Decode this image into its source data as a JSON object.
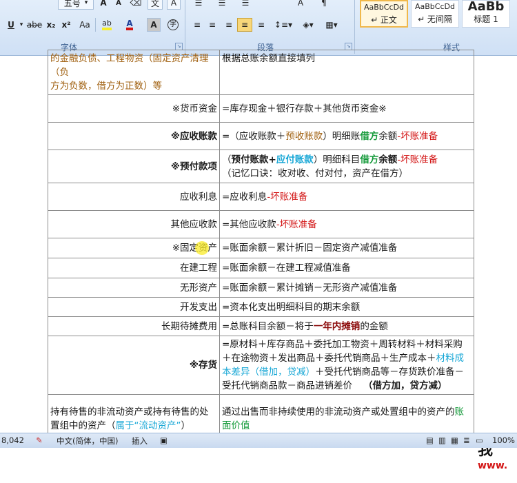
{
  "ribbon": {
    "font_size_value": "五号",
    "font_group_label": "字体",
    "paragraph_group_label": "段落",
    "styles_group_label": "样式",
    "format_buttons": [
      "U",
      "abe",
      "x₂",
      "x²",
      "Aa"
    ],
    "styles": [
      {
        "sample": "AaBbCcDd",
        "name": "↵ 正文"
      },
      {
        "sample": "AaBbCcDd",
        "name": "↵ 无间隔"
      },
      {
        "sample": "AaBb",
        "name": "标题 1"
      }
    ]
  },
  "document": {
    "top_row": {
      "left_line1": "的金融负债、工程物资（固定资产清理（负",
      "left_line2": "方为负数，借方为正数）等",
      "right": "根据总账余额直接填列"
    },
    "rows": [
      {
        "left": "※货币资金",
        "right": "=库存现金＋银行存款＋其他货币资金※"
      },
      {
        "left": "※应收账款",
        "right_a": "=（应收账款＋",
        "right_b": "预收账款",
        "right_c": "）明细账",
        "right_d": "借方",
        "right_e": "余额",
        "right_f": "-坏账准备"
      },
      {
        "left": "※预付款项",
        "right_a": "（",
        "right_b": "预付账款",
        "right_c": "+",
        "right_d": "应付账款",
        "right_e": "）明细科目",
        "right_f": "借方",
        "right_g": "余额",
        "right_h": "-坏账准备",
        "right_line2": "（记忆口诀：收对收、付对付，资产在借方）"
      },
      {
        "left": "应收利息",
        "right_a": "=应收利息",
        "right_b": "-坏账准备"
      },
      {
        "left": "其他应收款",
        "right_a": "=其他应收款",
        "right_b": "-坏账准备"
      },
      {
        "left": "※固定资产",
        "right": "=账面余额－累计折旧－固定资产减值准备"
      },
      {
        "left": "在建工程",
        "right": "=账面余额－在建工程减值准备"
      },
      {
        "left": "无形资产",
        "right": "=账面余额－累计摊销－无形资产减值准备"
      },
      {
        "left": "开发支出",
        "right": "=资本化支出明细科目的期末余额"
      },
      {
        "left": "长期待摊费用",
        "right_a": "=总账科目余额－将于",
        "right_b": "一年内摊销",
        "right_c": "的金额"
      },
      {
        "left": "※存货",
        "right_a": "=原材料＋库存商品＋委托加工物资＋周转材料＋材料采购＋在途物资＋发出商品＋委托代销商品＋生产成本＋",
        "right_b": "材料成本差异（借加，贷减）",
        "right_c": "＋受托代销商品等－存货跌价准备－受托代销商品款－商品进销差价",
        "right_d": "（借方加，贷方减）"
      },
      {
        "left_a": "持有待售的非流动资产或持有待售的处置组中的资产（",
        "left_b": "属于“流动资产”",
        "left_c": "）",
        "right_a": "通过出售而非持续使用的非流动资产或处置组中的资产的",
        "right_b": "账面价值"
      }
    ]
  },
  "status": {
    "word_count": "8,042",
    "language": "中文(简体，中国)",
    "insert_mode": "插入",
    "zoom": "100%"
  },
  "watermark": {
    "line1": "我",
    "line2": "www."
  },
  "colors": {
    "ribbon_bg": "#dbe7f6",
    "purple": "#7a2f9e",
    "green": "#159a3a",
    "cyan": "#17a7d6",
    "red": "#d31515"
  }
}
